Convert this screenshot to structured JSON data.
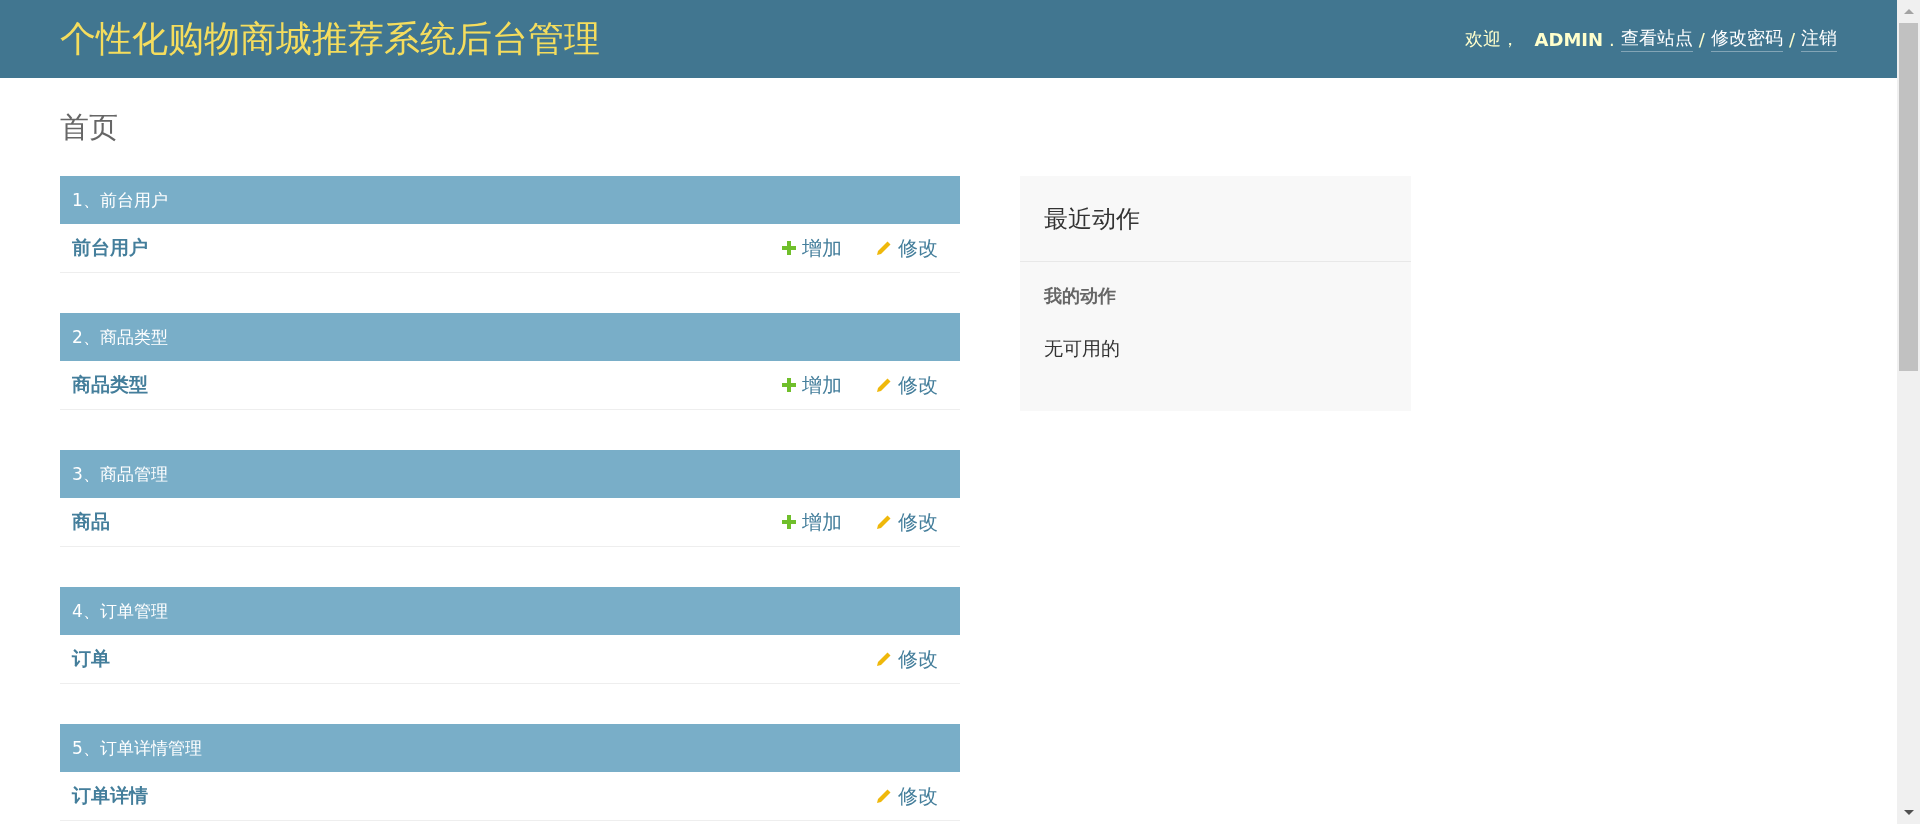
{
  "header": {
    "title": "个性化购物商城推荐系统后台管理",
    "tools": [
      {
        "kind": "text",
        "text": "欢迎，"
      },
      {
        "kind": "user",
        "text": "ADMIN"
      },
      {
        "kind": "sep",
        "text": "."
      },
      {
        "kind": "link",
        "text": "查看站点"
      },
      {
        "kind": "sep",
        "text": "/"
      },
      {
        "kind": "link",
        "text": "修改密码"
      },
      {
        "kind": "sep",
        "text": "/"
      },
      {
        "kind": "link",
        "text": "注销"
      }
    ]
  },
  "page_title": "首页",
  "modules": [
    {
      "caption": "1、前台用户",
      "rows": [
        {
          "name": "前台用户",
          "actions": [
            {
              "kind": "add",
              "label": "增加"
            },
            {
              "kind": "change",
              "label": "修改"
            }
          ]
        }
      ]
    },
    {
      "caption": "2、商品类型",
      "rows": [
        {
          "name": "商品类型",
          "actions": [
            {
              "kind": "add",
              "label": "增加"
            },
            {
              "kind": "change",
              "label": "修改"
            }
          ]
        }
      ]
    },
    {
      "caption": "3、商品管理",
      "rows": [
        {
          "name": "商品",
          "actions": [
            {
              "kind": "add",
              "label": "增加"
            },
            {
              "kind": "change",
              "label": "修改"
            }
          ]
        }
      ]
    },
    {
      "caption": "4、订单管理",
      "rows": [
        {
          "name": "订单",
          "actions": [
            {
              "kind": "change",
              "label": "修改"
            }
          ]
        }
      ]
    },
    {
      "caption": "5、订单详情管理",
      "rows": [
        {
          "name": "订单详情",
          "actions": [
            {
              "kind": "change",
              "label": "修改"
            }
          ]
        }
      ]
    }
  ],
  "recent_actions": {
    "title": "最近动作",
    "subtitle": "我的动作",
    "empty": "无可用的"
  }
}
